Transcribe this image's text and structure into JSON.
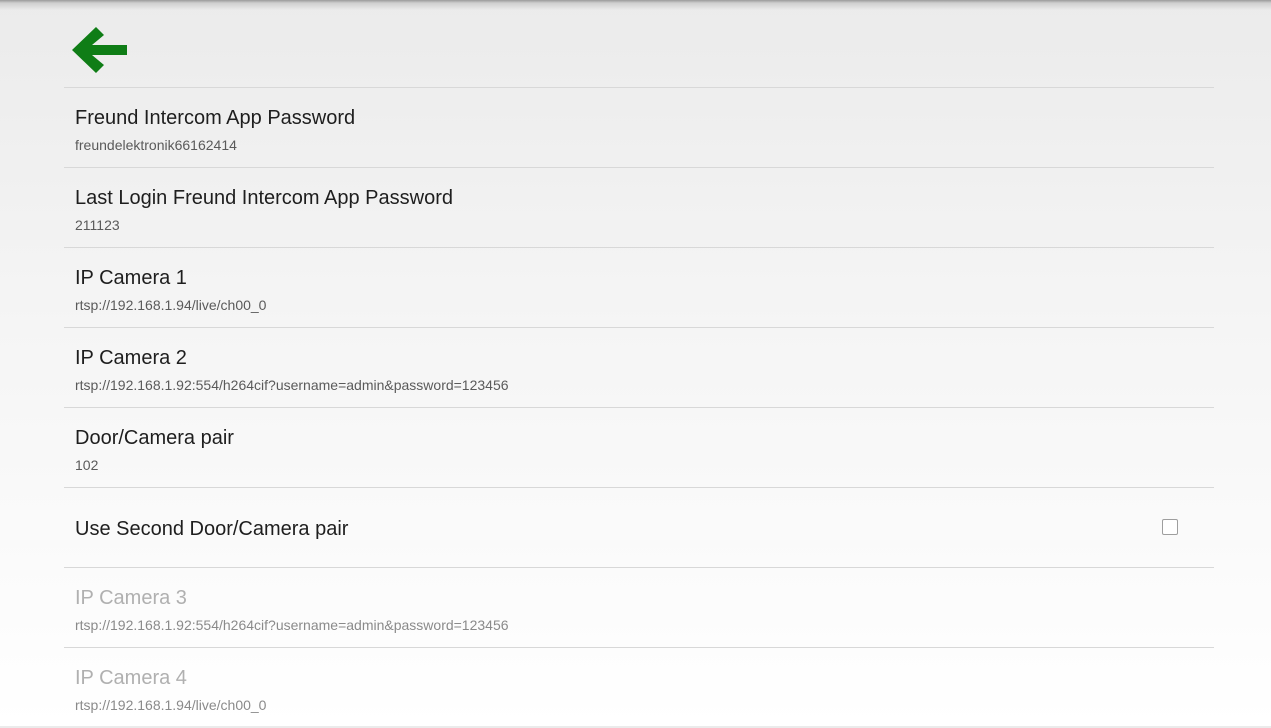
{
  "header": {
    "back_icon": "arrow-left-icon",
    "back_icon_color": "#0f7d16"
  },
  "preferences": [
    {
      "title": "Freund Intercom App Password",
      "summary": "freundelektronik66162414"
    },
    {
      "title": "Last Login Freund Intercom App Password",
      "summary": "211123"
    },
    {
      "title": "IP Camera 1",
      "summary": "rtsp://192.168.1.94/live/ch00_0"
    },
    {
      "title": "IP Camera 2",
      "summary": "rtsp://192.168.1.92:554/h264cif?username=admin&password=123456"
    },
    {
      "title": "Door/Camera pair",
      "summary": "102"
    },
    {
      "title": "Use Second Door/Camera pair",
      "checkbox": {
        "checked": false
      }
    },
    {
      "title": "IP Camera 3",
      "summary": "rtsp://192.168.1.92:554/h264cif?username=admin&password=123456",
      "disabled": true
    },
    {
      "title": "IP Camera 4",
      "summary": "rtsp://192.168.1.94/live/ch00_0",
      "disabled": true
    }
  ]
}
